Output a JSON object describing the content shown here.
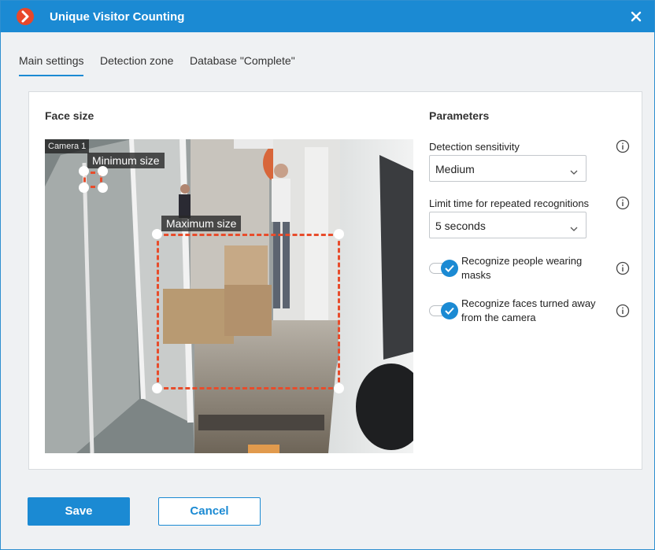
{
  "window": {
    "title": "Unique Visitor Counting"
  },
  "tabs": [
    {
      "label": "Main settings",
      "active": true
    },
    {
      "label": "Detection zone",
      "active": false
    },
    {
      "label": "Database \"Complete\"",
      "active": false
    }
  ],
  "face_size": {
    "title": "Face size",
    "camera_label": "Camera 1",
    "minimum_label": "Minimum size",
    "maximum_label": "Maximum size"
  },
  "parameters": {
    "title": "Parameters",
    "detection_sensitivity": {
      "label": "Detection sensitivity",
      "value": "Medium"
    },
    "repeat_limit": {
      "label": "Limit time for repeated recognitions",
      "value": "5 seconds"
    },
    "masks": {
      "label": "Recognize people wearing masks",
      "checked": true
    },
    "turned_away": {
      "label": "Recognize faces turned away from the camera",
      "checked": true
    }
  },
  "buttons": {
    "save": "Save",
    "cancel": "Cancel"
  },
  "colors": {
    "accent": "#1b8ad3",
    "zone": "#e84c2b",
    "logo": "#e8472a"
  }
}
